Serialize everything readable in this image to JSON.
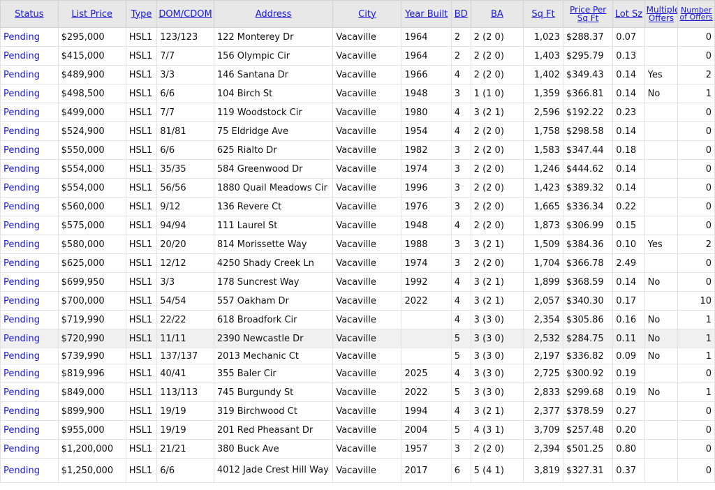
{
  "columns": [
    "Status",
    "List Price",
    "Type",
    "DOM/CDOM",
    "Address",
    "City",
    "Year Built",
    "BD",
    "BA",
    "Sq Ft",
    "Price Per Sq Ft",
    "Lot Sz",
    "Multiple Offers",
    "Number of Offers"
  ],
  "rows": [
    [
      "Pending",
      "$295,000",
      "HSL1",
      "123/123",
      "122 Monterey Dr",
      "Vacaville",
      "1964",
      "2",
      "2 (2 0)",
      "1,023",
      "$288.37",
      "0.07",
      "",
      "0"
    ],
    [
      "Pending",
      "$415,000",
      "HSL1",
      "7/7",
      "156 Olympic Cir",
      "Vacaville",
      "1964",
      "2",
      "2 (2 0)",
      "1,403",
      "$295.79",
      "0.13",
      "",
      "0"
    ],
    [
      "Pending",
      "$489,900",
      "HSL1",
      "3/3",
      "146 Santana Dr",
      "Vacaville",
      "1966",
      "4",
      "2 (2 0)",
      "1,402",
      "$349.43",
      "0.14",
      "Yes",
      "2"
    ],
    [
      "Pending",
      "$498,500",
      "HSL1",
      "6/6",
      "104 Birch St",
      "Vacaville",
      "1948",
      "3",
      "1 (1 0)",
      "1,359",
      "$366.81",
      "0.14",
      "No",
      "1"
    ],
    [
      "Pending",
      "$499,000",
      "HSL1",
      "7/7",
      "119 Woodstock Cir",
      "Vacaville",
      "1980",
      "4",
      "3 (2 1)",
      "2,596",
      "$192.22",
      "0.23",
      "",
      "0"
    ],
    [
      "Pending",
      "$524,900",
      "HSL1",
      "81/81",
      "75 Eldridge Ave",
      "Vacaville",
      "1954",
      "4",
      "2 (2 0)",
      "1,758",
      "$298.58",
      "0.14",
      "",
      "0"
    ],
    [
      "Pending",
      "$550,000",
      "HSL1",
      "6/6",
      "625 Rialto Dr",
      "Vacaville",
      "1982",
      "3",
      "2 (2 0)",
      "1,583",
      "$347.44",
      "0.18",
      "",
      "0"
    ],
    [
      "Pending",
      "$554,000",
      "HSL1",
      "35/35",
      "584 Greenwood Dr",
      "Vacaville",
      "1974",
      "3",
      "2 (2 0)",
      "1,246",
      "$444.62",
      "0.14",
      "",
      "0"
    ],
    [
      "Pending",
      "$554,000",
      "HSL1",
      "56/56",
      "1880 Quail Meadows Cir",
      "Vacaville",
      "1996",
      "3",
      "2 (2 0)",
      "1,423",
      "$389.32",
      "0.14",
      "",
      "0"
    ],
    [
      "Pending",
      "$560,000",
      "HSL1",
      "9/12",
      "136 Revere Ct",
      "Vacaville",
      "1976",
      "3",
      "2 (2 0)",
      "1,665",
      "$336.34",
      "0.22",
      "",
      "0"
    ],
    [
      "Pending",
      "$575,000",
      "HSL1",
      "94/94",
      "111 Laurel St",
      "Vacaville",
      "1948",
      "4",
      "2 (2 0)",
      "1,873",
      "$306.99",
      "0.15",
      "",
      "0"
    ],
    [
      "Pending",
      "$580,000",
      "HSL1",
      "20/20",
      "814 Morissette Way",
      "Vacaville",
      "1988",
      "3",
      "3 (2 1)",
      "1,509",
      "$384.36",
      "0.10",
      "Yes",
      "2"
    ],
    [
      "Pending",
      "$625,000",
      "HSL1",
      "12/12",
      "4250 Shady Creek Ln",
      "Vacaville",
      "1974",
      "3",
      "2 (2 0)",
      "1,704",
      "$366.78",
      "2.49",
      "",
      "0"
    ],
    [
      "Pending",
      "$699,950",
      "HSL1",
      "3/3",
      "178 Suncrest Way",
      "Vacaville",
      "1992",
      "4",
      "3 (2 1)",
      "1,899",
      "$368.59",
      "0.14",
      "No",
      "0"
    ],
    [
      "Pending",
      "$700,000",
      "HSL1",
      "54/54",
      "557 Oakham Dr",
      "Vacaville",
      "2022",
      "4",
      "3 (2 1)",
      "2,057",
      "$340.30",
      "0.17",
      "",
      "10"
    ],
    [
      "Pending",
      "$719,990",
      "HSL1",
      "22/22",
      "618 Broadfork Cir",
      "Vacaville",
      "",
      "4",
      "3 (3 0)",
      "2,354",
      "$305.86",
      "0.16",
      "No",
      "1"
    ],
    [
      "Pending",
      "$720,990",
      "HSL1",
      "11/11",
      "2390 Newcastle Dr",
      "Vacaville",
      "",
      "5",
      "3 (3 0)",
      "2,532",
      "$284.75",
      "0.11",
      "No",
      "1"
    ],
    [
      "Pending",
      "$739,990",
      "HSL1",
      "137/137",
      "2013 Mechanic Ct",
      "Vacaville",
      "",
      "5",
      "3 (3 0)",
      "2,197",
      "$336.82",
      "0.09",
      "No",
      "1"
    ],
    [
      "Pending",
      "$819,996",
      "HSL1",
      "40/41",
      "355 Baler Cir",
      "Vacaville",
      "2025",
      "4",
      "3 (3 0)",
      "2,725",
      "$300.92",
      "0.19",
      "",
      "0"
    ],
    [
      "Pending",
      "$849,000",
      "HSL1",
      "113/113",
      "745 Burgundy St",
      "Vacaville",
      "2022",
      "5",
      "3 (3 0)",
      "2,833",
      "$299.68",
      "0.19",
      "No",
      "1"
    ],
    [
      "Pending",
      "$899,900",
      "HSL1",
      "19/19",
      "319 Birchwood Ct",
      "Vacaville",
      "1994",
      "4",
      "3 (2 1)",
      "2,377",
      "$378.59",
      "0.27",
      "",
      "0"
    ],
    [
      "Pending",
      "$955,000",
      "HSL1",
      "19/19",
      "201 Red Pheasant Dr",
      "Vacaville",
      "2004",
      "5",
      "4 (3 1)",
      "3,709",
      "$257.48",
      "0.20",
      "",
      "0"
    ],
    [
      "Pending",
      "$1,200,000",
      "HSL1",
      "21/21",
      "380 Buck Ave",
      "Vacaville",
      "1957",
      "3",
      "2 (2 0)",
      "2,394",
      "$501.25",
      "0.80",
      "",
      "0"
    ],
    [
      "Pending",
      "$1,250,000",
      "HSL1",
      "6/6",
      "4012 Jade Crest Hill Way",
      "Vacaville",
      "2017",
      "6",
      "5 (4 1)",
      "3,819",
      "$327.31",
      "0.37",
      "",
      "0"
    ]
  ],
  "highlighted_row": 16,
  "colors": {
    "link": "#1a1ad6",
    "header_bg": "#e8e8e8",
    "highlight_bg": "#f0f0f0"
  }
}
